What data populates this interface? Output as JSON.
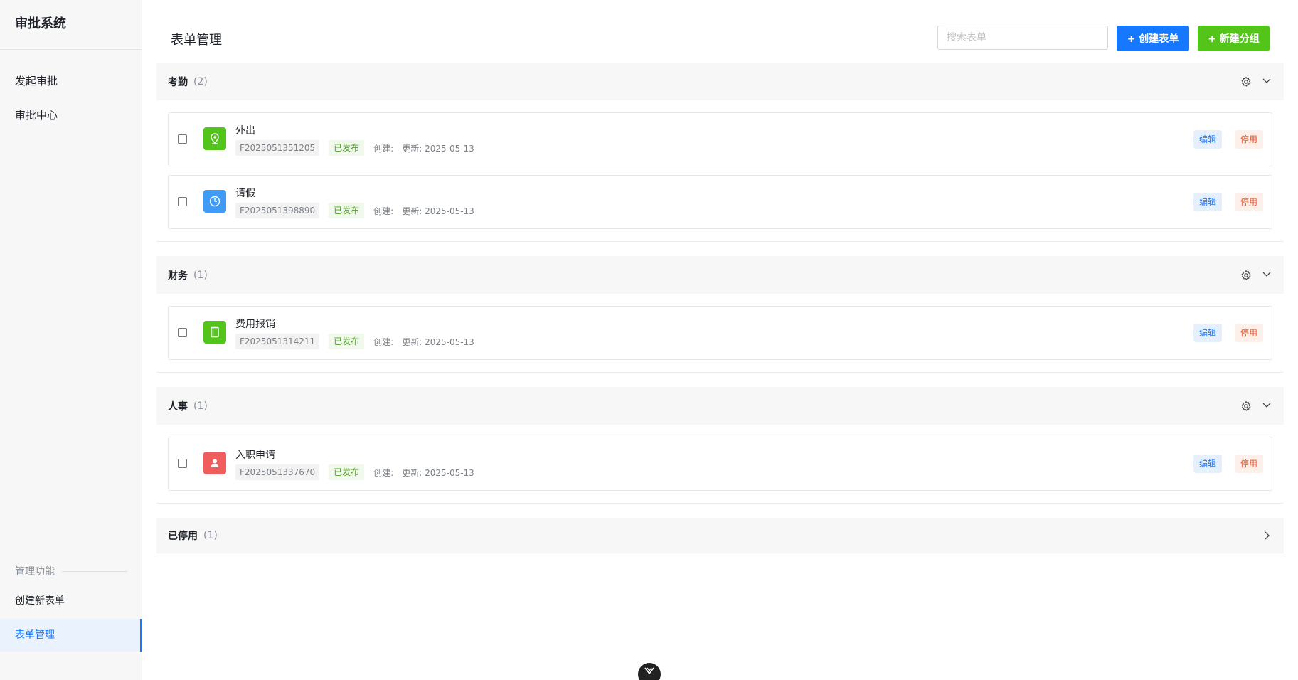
{
  "app": {
    "title": "审批系统"
  },
  "sidebar": {
    "items": [
      {
        "label": "发起审批"
      },
      {
        "label": "审批中心"
      }
    ],
    "section_label": "管理功能",
    "admin_items": [
      {
        "label": "创建新表单"
      },
      {
        "label": "表单管理",
        "active": true
      }
    ]
  },
  "header": {
    "title": "表单管理",
    "search_placeholder": "搜索表单",
    "create_button": "+ 创建表单",
    "new_group_button": "+ 新建分组"
  },
  "groups": [
    {
      "name": "考勤",
      "count": "(2)",
      "forms": [
        {
          "name": "外出",
          "code": "F2025051351205",
          "status": "已发布",
          "created": "创建:",
          "updated": "更新: 2025-05-13",
          "icon": "location-icon",
          "color": "#52c41a",
          "edit": "编辑",
          "disable": "停用"
        },
        {
          "name": "请假",
          "code": "F2025051398890",
          "status": "已发布",
          "created": "创建:",
          "updated": "更新: 2025-05-13",
          "icon": "clock-icon",
          "color": "#3f9bf5",
          "edit": "编辑",
          "disable": "停用"
        }
      ]
    },
    {
      "name": "财务",
      "count": "(1)",
      "forms": [
        {
          "name": "费用报销",
          "code": "F2025051314211",
          "status": "已发布",
          "created": "创建:",
          "updated": "更新: 2025-05-13",
          "icon": "book-icon",
          "color": "#52c41a",
          "edit": "编辑",
          "disable": "停用"
        }
      ]
    },
    {
      "name": "人事",
      "count": "(1)",
      "forms": [
        {
          "name": "入职申请",
          "code": "F2025051337670",
          "status": "已发布",
          "created": "创建:",
          "updated": "更新: 2025-05-13",
          "icon": "user-icon",
          "color": "#ef5d5d",
          "edit": "编辑",
          "disable": "停用"
        }
      ]
    }
  ],
  "disabled_group": {
    "name": "已停用",
    "count": "(1)"
  }
}
